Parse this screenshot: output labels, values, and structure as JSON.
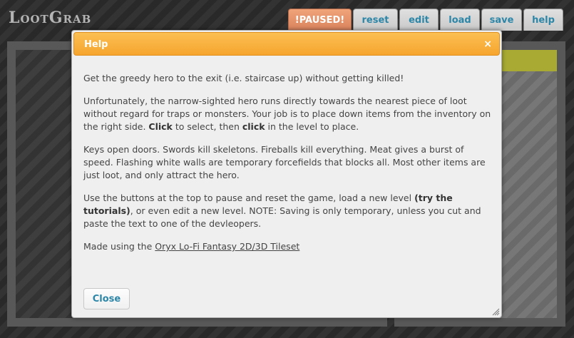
{
  "app": {
    "title": "LootGrab"
  },
  "toolbar": {
    "buttons": [
      {
        "label": "!PAUSED!"
      },
      {
        "label": "reset"
      },
      {
        "label": "edit"
      },
      {
        "label": "load"
      },
      {
        "label": "save"
      },
      {
        "label": "help"
      }
    ]
  },
  "dialog": {
    "title": "Help",
    "close_glyph": "×",
    "intro": "Get the greedy hero to the exit (i.e. staircase up) without getting killed!",
    "p2": {
      "text1": "Unfortunately, the narrow-sighted hero runs directly towards the nearest piece of loot without regard for traps or monsters. Your job is to place down items from the inventory on the right side. ",
      "bold1": "Click",
      "text2": " to select, then ",
      "bold2": "click",
      "text3": " in the level to place."
    },
    "p3": "Keys open doors. Swords kill skeletons. Fireballs kill everything. Meat gives a burst of speed. Flashing white walls are temporary forcefields that blocks all. Most other items are just loot, and only attract the hero.",
    "p4": {
      "text1": "Use the buttons at the top to pause and reset the game, load a new level ",
      "bold1": "(try the tutorials)",
      "text2": ", or even edit a new level. NOTE: Saving is only temporary, unless you cut and paste the text to one of the devleopers."
    },
    "p5": {
      "text1": "Made using the ",
      "link": "Oryx Lo-Fi Fantasy 2D/3D Tileset"
    },
    "close_button": "Close"
  }
}
